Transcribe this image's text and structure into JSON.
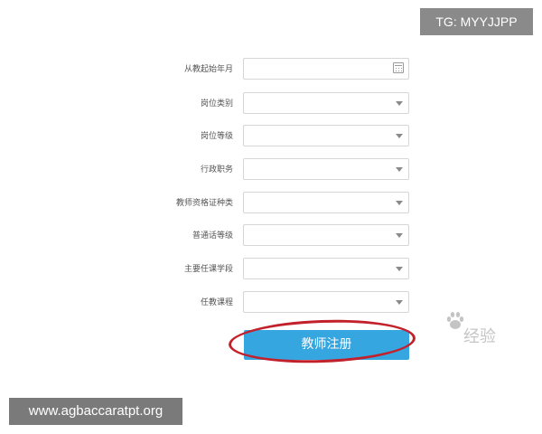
{
  "form": {
    "fields": [
      {
        "label": "从教起始年月",
        "control": "date"
      },
      {
        "label": "岗位类别",
        "control": "select"
      },
      {
        "label": "岗位等级",
        "control": "select"
      },
      {
        "label": "行政职务",
        "control": "select"
      },
      {
        "label": "教师资格证种类",
        "control": "select"
      },
      {
        "label": "普通话等级",
        "control": "select"
      },
      {
        "label": "主要任课学段",
        "control": "select"
      },
      {
        "label": "任教课程",
        "control": "select"
      }
    ],
    "submit_label": "教师注册"
  },
  "watermarks": {
    "tg": "TG: MYYJJPP",
    "site": "www.agbaccaratpt.org",
    "baidu": "经验"
  },
  "colors": {
    "button": "#36a6e0",
    "highlight_oval": "#c2212b"
  }
}
